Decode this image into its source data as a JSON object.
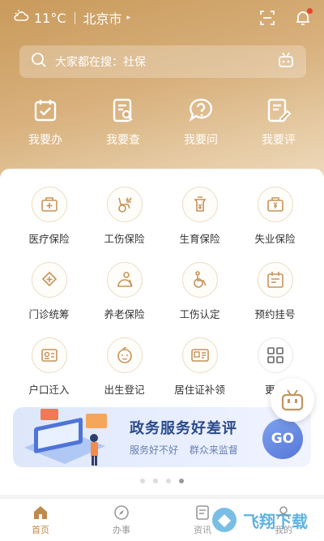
{
  "status": {
    "weather_icon": "cloud-icon",
    "temperature": "11°C",
    "city": "北京市",
    "city_caret": "▸"
  },
  "search": {
    "placeholder": "大家都在搜：社保"
  },
  "quick_actions": [
    {
      "label": "我要办",
      "icon": "calendar-check-icon"
    },
    {
      "label": "我要查",
      "icon": "search-document-icon"
    },
    {
      "label": "我要问",
      "icon": "question-bubble-icon"
    },
    {
      "label": "我要评",
      "icon": "edit-document-icon"
    }
  ],
  "services": [
    {
      "label": "医疗保险",
      "icon": "medical-box-icon"
    },
    {
      "label": "工伤保险",
      "icon": "wheelchair-yuan-icon"
    },
    {
      "label": "生育保险",
      "icon": "baby-bottle-icon"
    },
    {
      "label": "失业保险",
      "icon": "briefcase-yuan-icon"
    },
    {
      "label": "门诊统筹",
      "icon": "clinic-icon"
    },
    {
      "label": "养老保险",
      "icon": "elder-icon"
    },
    {
      "label": "工伤认定",
      "icon": "wheelchair-icon"
    },
    {
      "label": "预约挂号",
      "icon": "calendar-icon"
    },
    {
      "label": "户口迁入",
      "icon": "id-card-icon"
    },
    {
      "label": "出生登记",
      "icon": "baby-face-icon"
    },
    {
      "label": "居住证补领",
      "icon": "residence-card-icon"
    },
    {
      "label": "更多",
      "icon": "grid-icon"
    }
  ],
  "banner": {
    "title": "政务服务好差评",
    "sub_left": "服务好不好",
    "sub_right": "群众来监督",
    "button": "GO"
  },
  "carousel": {
    "count": 4,
    "active_index": 3
  },
  "tabs": [
    {
      "label": "首页",
      "icon": "home-icon",
      "active": true
    },
    {
      "label": "办事",
      "icon": "compass-icon",
      "active": false
    },
    {
      "label": "资讯",
      "icon": "news-icon",
      "active": false
    },
    {
      "label": "我的",
      "icon": "user-icon",
      "active": false
    }
  ],
  "watermark": {
    "text": "飞翔下载"
  },
  "colors": {
    "accent": "#c08a4d",
    "header_gradient_start": "#c99a5b",
    "banner_text": "#2a4a8a"
  }
}
